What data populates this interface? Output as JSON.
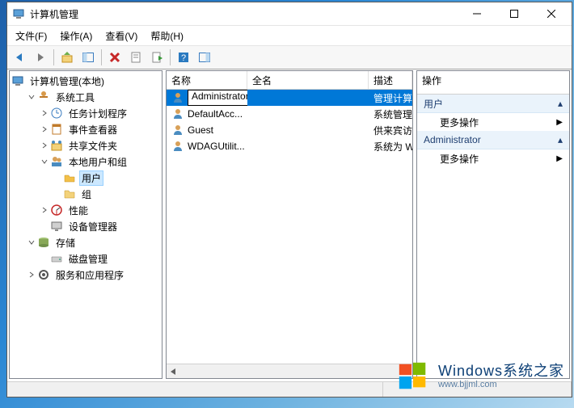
{
  "window": {
    "title": "计算机管理"
  },
  "menu": [
    "文件(F)",
    "操作(A)",
    "查看(V)",
    "帮助(H)"
  ],
  "tree": {
    "root": "计算机管理(本地)",
    "nodes": [
      {
        "label": "系统工具",
        "expanded": true,
        "depth": 1,
        "icon": "tools",
        "expander": true
      },
      {
        "label": "任务计划程序",
        "depth": 2,
        "icon": "clock",
        "expander": "collapsed"
      },
      {
        "label": "事件查看器",
        "depth": 2,
        "icon": "event",
        "expander": "collapsed"
      },
      {
        "label": "共享文件夹",
        "depth": 2,
        "icon": "share",
        "expander": "collapsed"
      },
      {
        "label": "本地用户和组",
        "expanded": true,
        "depth": 2,
        "icon": "users",
        "expander": true
      },
      {
        "label": "用户",
        "depth": 3,
        "icon": "folder-open",
        "selected": true
      },
      {
        "label": "组",
        "depth": 3,
        "icon": "folder"
      },
      {
        "label": "性能",
        "depth": 2,
        "icon": "perf",
        "expander": "collapsed"
      },
      {
        "label": "设备管理器",
        "depth": 2,
        "icon": "device"
      },
      {
        "label": "存储",
        "expanded": true,
        "depth": 1,
        "icon": "storage",
        "expander": true
      },
      {
        "label": "磁盘管理",
        "depth": 2,
        "icon": "disk"
      },
      {
        "label": "服务和应用程序",
        "depth": 1,
        "icon": "services",
        "expander": "collapsed"
      }
    ]
  },
  "list": {
    "columns": {
      "name": "名称",
      "full": "全名",
      "desc": "描述"
    },
    "rows": [
      {
        "name": "Administrator",
        "full": "",
        "desc": "管理计算",
        "selected": true,
        "editing": true
      },
      {
        "name": "DefaultAcc...",
        "full": "",
        "desc": "系统管理"
      },
      {
        "name": "Guest",
        "full": "",
        "desc": "供来宾访"
      },
      {
        "name": "WDAGUtilit...",
        "full": "",
        "desc": "系统为 W"
      }
    ]
  },
  "actions": {
    "header": "操作",
    "sec1": "用户",
    "more1": "更多操作",
    "sec2": "Administrator",
    "more2": "更多操作"
  },
  "watermark": {
    "brand": "Windows",
    "sub": "系统之家",
    "url": "www.bjjml.com"
  }
}
